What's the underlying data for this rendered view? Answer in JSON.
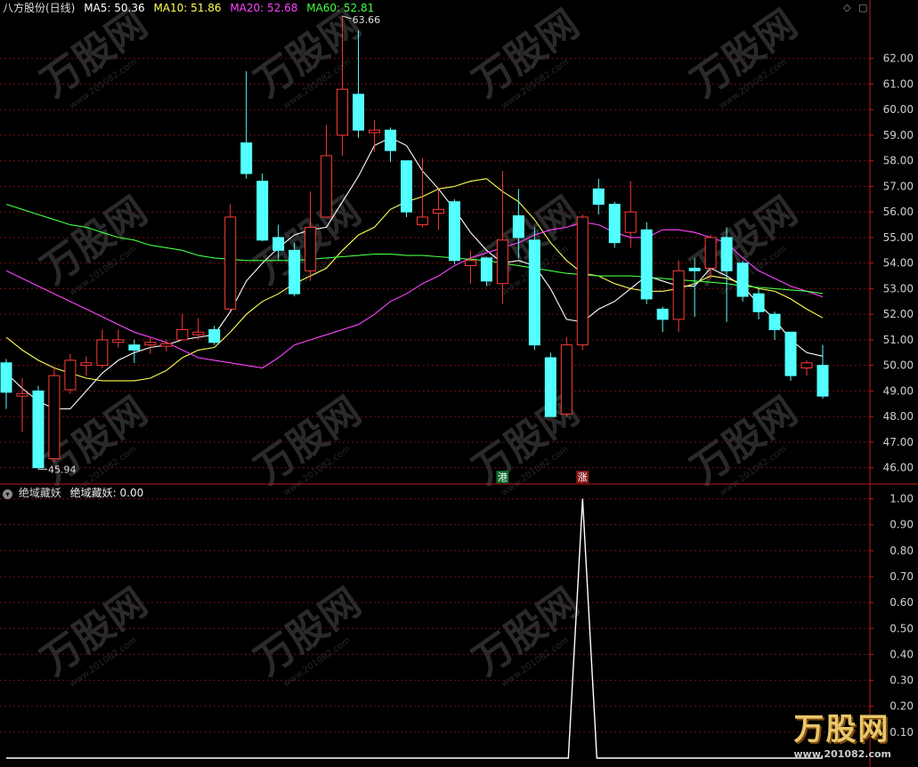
{
  "header": {
    "title": "八方股份(日线)",
    "ma_labels": [
      {
        "text": "MA5: 50.36",
        "color": "#ffffff"
      },
      {
        "text": "MA10: 51.86",
        "color": "#ffff55"
      },
      {
        "text": "MA20: 52.68",
        "color": "#ff44ff"
      },
      {
        "text": "MA60: 52.81",
        "color": "#44ff44"
      }
    ],
    "diamond": "◇",
    "square": "▢"
  },
  "indicator": {
    "name": "绝域藏妖",
    "value_label": "绝域藏妖: 0.00"
  },
  "markers": {
    "gang": "港",
    "zhang": "涨"
  },
  "colors": {
    "up": "#ff3c3c",
    "down": "#54ffff",
    "grid": "#7a1010",
    "axis": "#c01a1a"
  },
  "watermark": {
    "brand": "万股网",
    "url": "www.201082.com"
  },
  "chart_data": [
    {
      "type": "candlestick",
      "ylim": [
        45.5,
        63.8
      ],
      "yticks": [
        46.0,
        47.0,
        48.0,
        49.0,
        50.0,
        51.0,
        52.0,
        53.0,
        54.0,
        55.0,
        56.0,
        57.0,
        58.0,
        59.0,
        60.0,
        61.0,
        62.0
      ],
      "annotations": [
        {
          "text": "63.66",
          "value": 63.66
        },
        {
          "text": "45.94",
          "value": 45.94
        }
      ],
      "candles": [
        [
          50.1,
          48.95,
          48.3,
          50.25
        ],
        [
          48.8,
          48.9,
          47.4,
          49.5
        ],
        [
          49.0,
          46.0,
          45.94,
          49.2
        ],
        [
          46.35,
          49.6,
          46.2,
          49.95
        ],
        [
          49.05,
          50.2,
          48.9,
          50.45
        ],
        [
          50.0,
          50.1,
          49.6,
          50.35
        ],
        [
          50.0,
          51.0,
          49.9,
          51.4
        ],
        [
          50.9,
          51.0,
          50.7,
          51.4
        ],
        [
          50.8,
          50.6,
          50.1,
          51.0
        ],
        [
          50.8,
          50.9,
          50.45,
          51.1
        ],
        [
          50.75,
          50.85,
          50.55,
          51.0
        ],
        [
          51.0,
          51.4,
          51.0,
          52.0
        ],
        [
          51.2,
          51.3,
          51.0,
          51.85
        ],
        [
          51.4,
          50.9,
          50.8,
          51.55
        ],
        [
          52.2,
          55.8,
          52.2,
          56.3
        ],
        [
          58.7,
          57.5,
          57.3,
          61.5
        ],
        [
          57.2,
          54.9,
          54.85,
          57.5
        ],
        [
          55.0,
          54.5,
          54.1,
          55.5
        ],
        [
          54.5,
          52.8,
          52.7,
          54.8
        ],
        [
          53.7,
          55.4,
          53.3,
          56.8
        ],
        [
          55.8,
          58.2,
          55.8,
          59.4
        ],
        [
          59.0,
          60.8,
          58.2,
          63.66
        ],
        [
          60.6,
          59.2,
          58.9,
          63.1
        ],
        [
          59.1,
          59.2,
          58.35,
          59.6
        ],
        [
          59.2,
          58.4,
          57.95,
          59.3
        ],
        [
          58.0,
          56.0,
          55.8,
          58.0
        ],
        [
          55.5,
          55.8,
          55.4,
          58.1
        ],
        [
          55.95,
          56.1,
          55.3,
          56.9
        ],
        [
          56.4,
          54.1,
          53.95,
          56.5
        ],
        [
          53.9,
          54.1,
          53.2,
          54.5
        ],
        [
          54.2,
          53.3,
          53.1,
          54.25
        ],
        [
          53.2,
          54.9,
          52.4,
          57.6
        ],
        [
          55.85,
          55.0,
          54.2,
          56.9
        ],
        [
          54.9,
          50.8,
          50.6,
          55.4
        ],
        [
          50.3,
          48.0,
          48.0,
          50.5
        ],
        [
          48.1,
          50.8,
          48.0,
          51.1
        ],
        [
          50.8,
          55.8,
          50.6,
          55.9
        ],
        [
          56.9,
          56.3,
          55.9,
          57.3
        ],
        [
          56.3,
          54.8,
          54.6,
          56.4
        ],
        [
          55.2,
          56.0,
          54.6,
          57.2
        ],
        [
          55.3,
          52.6,
          52.4,
          55.6
        ],
        [
          52.2,
          51.8,
          51.3,
          52.3
        ],
        [
          51.8,
          53.7,
          51.3,
          54.1
        ],
        [
          53.8,
          53.7,
          51.9,
          54.2
        ],
        [
          53.8,
          55.0,
          53.4,
          55.1
        ],
        [
          55.0,
          53.7,
          51.7,
          55.4
        ],
        [
          54.0,
          52.7,
          52.5,
          54.1
        ],
        [
          52.8,
          52.1,
          51.8,
          53.0
        ],
        [
          52.0,
          51.4,
          51.0,
          52.1
        ],
        [
          51.3,
          49.6,
          49.4,
          51.3
        ],
        [
          49.9,
          50.1,
          49.6,
          50.2
        ],
        [
          50.0,
          48.8,
          48.7,
          50.8
        ]
      ],
      "series": [
        {
          "name": "MA5",
          "color": "#ffffff",
          "values": [
            49.7,
            49.1,
            48.6,
            48.3,
            48.3,
            49.0,
            49.7,
            50.2,
            50.5,
            50.7,
            50.8,
            51.0,
            51.1,
            51.2,
            52.1,
            53.3,
            54.0,
            54.6,
            55.1,
            55.3,
            55.4,
            56.4,
            57.4,
            58.6,
            58.9,
            58.6,
            57.6,
            56.9,
            56.1,
            55.2,
            54.5,
            54.0,
            54.1,
            53.9,
            53.0,
            51.8,
            51.7,
            52.2,
            52.5,
            53.0,
            53.5,
            53.3,
            53.1,
            53.1,
            53.8,
            53.5,
            53.1,
            52.4,
            51.8,
            51.0,
            50.5,
            50.36
          ]
        },
        {
          "name": "MA10",
          "color": "#ffff55",
          "values": [
            51.1,
            50.6,
            50.2,
            49.9,
            49.7,
            49.5,
            49.4,
            49.4,
            49.4,
            49.5,
            49.8,
            50.3,
            50.6,
            50.7,
            51.3,
            52.0,
            52.5,
            52.8,
            53.2,
            53.5,
            53.8,
            54.5,
            55.1,
            55.4,
            56.1,
            56.4,
            56.6,
            56.9,
            57.0,
            57.2,
            57.3,
            56.8,
            56.4,
            55.7,
            54.8,
            54.1,
            53.6,
            53.5,
            53.2,
            53.0,
            52.9,
            52.9,
            53.0,
            53.2,
            53.5,
            53.4,
            53.2,
            53.0,
            52.9,
            52.6,
            52.2,
            51.86
          ]
        },
        {
          "name": "MA20",
          "color": "#ff44ff",
          "values": [
            53.7,
            53.4,
            53.1,
            52.8,
            52.5,
            52.2,
            51.9,
            51.6,
            51.3,
            51.1,
            50.9,
            50.6,
            50.3,
            50.2,
            50.1,
            50.0,
            49.9,
            50.3,
            50.8,
            51.0,
            51.2,
            51.4,
            51.6,
            52.0,
            52.5,
            52.8,
            53.2,
            53.5,
            53.9,
            54.2,
            54.4,
            54.6,
            54.8,
            55.1,
            55.3,
            55.4,
            55.6,
            55.5,
            55.2,
            55.0,
            55.0,
            55.3,
            55.3,
            55.2,
            55.0,
            54.8,
            54.2,
            53.7,
            53.4,
            53.1,
            52.9,
            52.68
          ]
        },
        {
          "name": "MA60",
          "color": "#44ff44",
          "values": [
            56.3,
            56.1,
            55.9,
            55.7,
            55.5,
            55.4,
            55.2,
            55.0,
            54.9,
            54.7,
            54.6,
            54.5,
            54.3,
            54.2,
            54.15,
            54.1,
            54.1,
            54.1,
            54.1,
            54.15,
            54.2,
            54.25,
            54.3,
            54.35,
            54.35,
            54.3,
            54.3,
            54.25,
            54.2,
            54.15,
            54.1,
            54.0,
            53.9,
            53.8,
            53.7,
            53.6,
            53.55,
            53.5,
            53.5,
            53.5,
            53.45,
            53.4,
            53.35,
            53.3,
            53.25,
            53.2,
            53.1,
            53.05,
            53.0,
            52.95,
            52.9,
            52.81
          ]
        }
      ]
    },
    {
      "type": "line",
      "title": "绝域藏妖",
      "ylim": [
        0,
        1.05
      ],
      "yticks": [
        0.1,
        0.2,
        0.3,
        0.4,
        0.5,
        0.6,
        0.7,
        0.8,
        0.9,
        1.0
      ],
      "values": [
        0,
        0,
        0,
        0,
        0,
        0,
        0,
        0,
        0,
        0,
        0,
        0,
        0,
        0,
        0,
        0,
        0,
        0,
        0,
        0,
        0,
        0,
        0,
        0,
        0,
        0,
        0,
        0,
        0,
        0,
        0,
        0,
        0,
        0,
        0,
        0,
        1,
        0,
        0,
        0,
        0,
        0,
        0,
        0,
        0,
        0,
        0,
        0,
        0,
        0,
        0,
        0
      ]
    }
  ]
}
